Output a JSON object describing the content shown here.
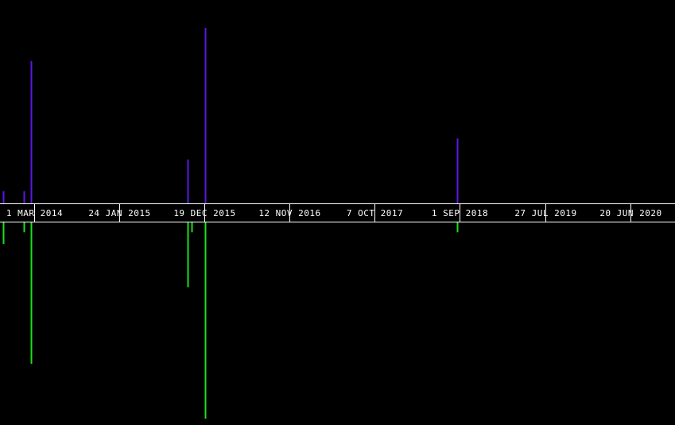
{
  "chart_data": {
    "type": "bar",
    "x_axis": {
      "type": "date",
      "range": [
        "2013-10-20",
        "2020-12-10"
      ],
      "ticks": [
        {
          "date": "2014-03-01",
          "label": "1 MAR 2014"
        },
        {
          "date": "2015-01-24",
          "label": "24 JAN 2015"
        },
        {
          "date": "2015-12-19",
          "label": "19 DEC 2015"
        },
        {
          "date": "2016-11-12",
          "label": "12 NOV 2016"
        },
        {
          "date": "2017-10-07",
          "label": "7 OCT 2017"
        },
        {
          "date": "2018-09-01",
          "label": "1 SEP 2018"
        },
        {
          "date": "2019-07-27",
          "label": "27 JUL 2019"
        },
        {
          "date": "2020-06-20",
          "label": "20 JUN 2020"
        }
      ]
    },
    "grid": false,
    "legend": "none",
    "series": [
      {
        "direction": "up",
        "color": "#5a18e6",
        "ylim": [
          0,
          100
        ],
        "points": [
          {
            "x": "2013-10-31",
            "y": 7
          },
          {
            "x": "2014-01-19",
            "y": 7
          },
          {
            "x": "2014-02-16",
            "y": 81
          },
          {
            "x": "2015-10-16",
            "y": 25
          },
          {
            "x": "2015-12-22",
            "y": 100
          },
          {
            "x": "2018-08-20",
            "y": 37
          }
        ]
      },
      {
        "direction": "down",
        "color": "#19e019",
        "ylim": [
          0,
          100
        ],
        "points": [
          {
            "x": "2013-10-31",
            "y": 11
          },
          {
            "x": "2014-01-19",
            "y": 5
          },
          {
            "x": "2014-02-16",
            "y": 72
          },
          {
            "x": "2015-10-16",
            "y": 33
          },
          {
            "x": "2015-10-31",
            "y": 5
          },
          {
            "x": "2015-12-22",
            "y": 100
          },
          {
            "x": "2018-08-20",
            "y": 5
          }
        ]
      }
    ]
  }
}
